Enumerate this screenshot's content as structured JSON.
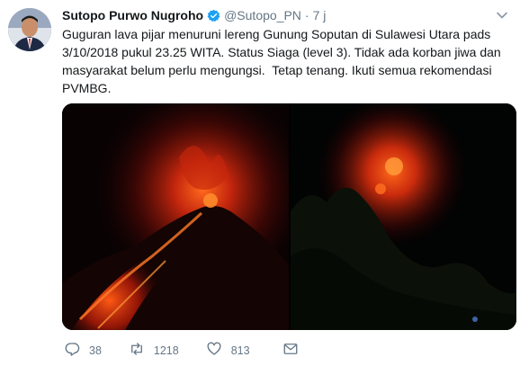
{
  "tweet": {
    "author_name": "Sutopo Purwo Nugroho",
    "handle": "@Sutopo_PN",
    "separator": "·",
    "time": "7 j",
    "text": "Guguran lava pijar menuruni lereng Gunung Soputan di Sulawesi Utara pads\n3/10/2018 pukul 23.25 WITA. Status Siaga (level 3). Tidak ada korban jiwa dan\nmasyarakat belum perlu mengungsi.  Tetap tenang. Ikuti semua rekomendasi\nPVMBG.",
    "verified": true
  },
  "media": {
    "photos": [
      "lava-flow-photo",
      "volcano-glow-photo"
    ]
  },
  "actions": {
    "replies": "38",
    "retweets": "1218",
    "likes": "813"
  },
  "icons": {
    "verified": "verified-badge-icon",
    "caret": "chevron-down-icon",
    "reply": "reply-icon",
    "retweet": "retweet-icon",
    "like": "heart-icon",
    "message": "envelope-icon"
  },
  "colors": {
    "verified": "#1da1f2",
    "secondary_text": "#657786",
    "lava": "#ff4a14"
  }
}
